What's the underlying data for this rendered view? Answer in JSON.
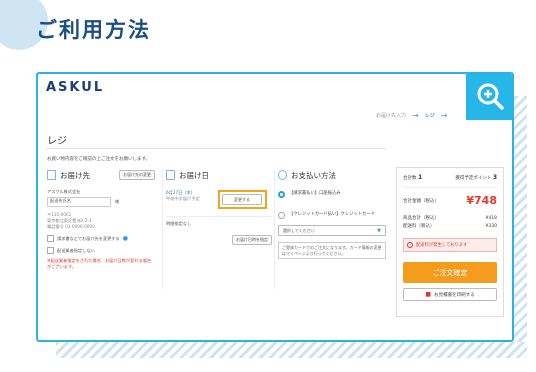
{
  "page": {
    "heading": "ご利用方法"
  },
  "frame": {
    "logo": "ASKUL",
    "zoom_icon": "zoom-in-icon",
    "steps": [
      "お届け先入力",
      "→",
      "レジ",
      "→"
    ],
    "title": "レジ",
    "notice": "お買い物内容をご確認の上ご注文をお願いします。",
    "delivery": {
      "title": "お届け先",
      "change_label": "お届け先の変更",
      "company_label": "アスクル株式会社",
      "name_value": "配送先氏名",
      "honorific": "様",
      "address_lines": [
        "〒135-0061",
        "東京都江東区豊洲3-2-3",
        "電話番号 03-0000-0000"
      ],
      "checkbox1": "請求書などでお届け先を変更する",
      "checkbox2": "配送業者指定しない",
      "warning": "※配送業者指定をされた場合、お届け日数が変わる場合がございます。"
    },
    "schedule": {
      "title": "お届け日",
      "date_text": "6月27日（木）",
      "time_text": "午前中お届け予定",
      "change_label": "変更する",
      "note_label": "時間指定なし",
      "reserve_label": "お届け日時を指定"
    },
    "payment": {
      "title": "お支払い方法",
      "option1": "【請求書払い】口座振込み",
      "option2": "【クレジットカード払い】クレジットカード",
      "select_placeholder": "選択してください",
      "info_text": "ご登録カードでのご注文になります。カード情報の変更はマイページより行ってください。"
    },
    "summary": {
      "count_label": "合計数",
      "count_value": "1",
      "points_label": "獲得予定ポイント",
      "points_value": "3",
      "total_label": "合計金額（税込）",
      "total_value": "¥748",
      "subtotal_label": "商品合計（税込）",
      "subtotal_value": "¥418",
      "shipping_label": "配送料（税込）",
      "shipping_value": "¥330",
      "alert_text": "配送料が発生しております",
      "order_label": "ご注文確定",
      "print_label": "お見積書を印刷する"
    }
  },
  "colors": {
    "accent": "#2db3e3",
    "heading": "#1a4f86",
    "order": "#f39c1e",
    "price": "#e5392d",
    "highlight": "#f0a51e"
  }
}
